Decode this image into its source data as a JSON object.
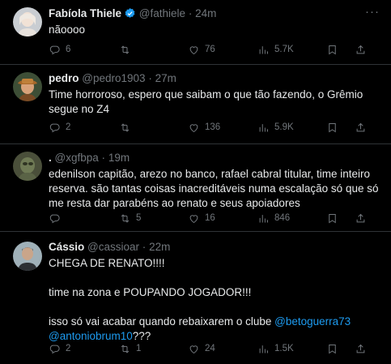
{
  "tweets": [
    {
      "name": "Fabíola Thiele",
      "handle": "@fathiele",
      "dot": "·",
      "time": "24m",
      "verified": true,
      "text": "nãoooo",
      "replies": "6",
      "retweets": "",
      "likes": "76",
      "views": "5.7K"
    },
    {
      "name": "pedro",
      "handle": "@pedro1903",
      "dot": "·",
      "time": "27m",
      "text": "Time horroroso, espero que saibam o que tão fazendo, o Grêmio segue no Z4",
      "replies": "2",
      "retweets": "",
      "likes": "136",
      "views": "5.9K"
    },
    {
      "name": ".",
      "handle": "@xgfbpa",
      "dot": "·",
      "time": "19m",
      "text": "edenilson capitão, arezo no banco, rafael cabral titular, time inteiro reserva. são tantas coisas inacreditáveis numa escalação só que só me resta dar parabéns ao renato e seus apoiadores",
      "replies": "",
      "retweets": "5",
      "likes": "16",
      "views": "846"
    },
    {
      "name": "Cássio",
      "handle": "@cassioar",
      "dot": "·",
      "time": "22m",
      "text_line1": "CHEGA DE RENATO!!!!",
      "text_line2": "time na zona e POUPANDO JOGADOR!!!",
      "text_line3": "isso só vai acabar quando rebaixarem o clube ",
      "mention1": "@betoguerra73",
      "mention2": "@antoniobrum10",
      "text_tail": "???",
      "replies": "2",
      "retweets": "1",
      "likes": "24",
      "views": "1.5K"
    }
  ],
  "more_label": "···",
  "icons": [
    "reply-icon",
    "retweet-icon",
    "like-icon",
    "views-icon",
    "bookmark-icon",
    "share-icon",
    "verified-badge-icon",
    "more-icon"
  ],
  "colors": {
    "background": "#000000",
    "text": "#e7e9ea",
    "muted": "#71767b",
    "link": "#1d9bf0",
    "divider": "#2f3336"
  }
}
